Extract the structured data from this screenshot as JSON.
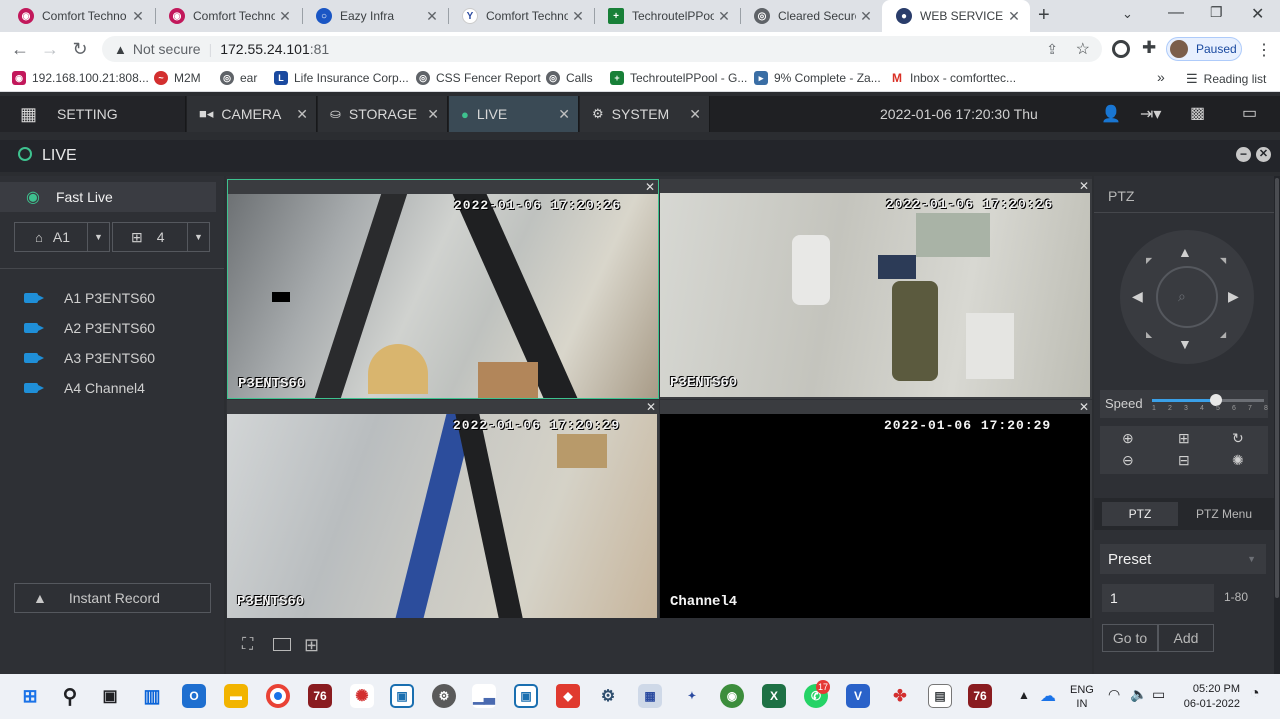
{
  "browser": {
    "tabs": [
      {
        "title": "Comfort Techno",
        "color": "#c2185b"
      },
      {
        "title": "Comfort Techno",
        "color": "#c2185b"
      },
      {
        "title": "Eazy Infra",
        "color": "#1a56c4"
      },
      {
        "title": "Comfort Techno",
        "color": "#2a4aa0"
      },
      {
        "title": "TechroutelPPool",
        "color": "#188038"
      },
      {
        "title": "Cleared Secured",
        "color": "#5f6368"
      },
      {
        "title": "WEB SERVICE",
        "color": "#2a3d6b"
      }
    ],
    "new_tab": "+",
    "security_label": "Not secure",
    "url_host": "172.55.24.101",
    "url_port": ":81",
    "profile_label": "Paused",
    "bookmarks": [
      {
        "label": "192.168.100.21:808...",
        "color": "#c2185b"
      },
      {
        "label": "M2M",
        "color": "#d32f2f"
      },
      {
        "label": "ear",
        "color": "#5f6368"
      },
      {
        "label": "Life Insurance Corp...",
        "color": "#1a4aa0"
      },
      {
        "label": "CSS Fencer Report",
        "color": "#5f6368"
      },
      {
        "label": "Calls",
        "color": "#5f6368"
      },
      {
        "label": "TechroutelPPool - G...",
        "color": "#188038"
      },
      {
        "label": "9% Complete - Za...",
        "color": "#3a6ea5"
      },
      {
        "label": "Inbox - comforttec...",
        "color": "#d93025"
      }
    ],
    "bookmarks_more": "»",
    "reading_list": "Reading list"
  },
  "app": {
    "nav_tabs": [
      {
        "label": "SETTING"
      },
      {
        "label": "CAMERA"
      },
      {
        "label": "STORAGE"
      },
      {
        "label": "LIVE"
      },
      {
        "label": "SYSTEM"
      }
    ],
    "datetime": "2022-01-06 17:20:30 Thu",
    "live_title": "LIVE",
    "fast_live": "Fast Live",
    "channel_select": "A1",
    "split_select": "4",
    "cameras": [
      {
        "label": "A1 P3ENTS60"
      },
      {
        "label": "A2 P3ENTS60"
      },
      {
        "label": "A3 P3ENTS60"
      },
      {
        "label": "A4 Channel4"
      }
    ],
    "instant_record": "Instant Record",
    "video_cells": [
      {
        "timestamp": "2022-01-06 17:20:26",
        "label": "P3ENTS60"
      },
      {
        "timestamp": "2022-01-06 17:20:26",
        "label": "P3ENTS60"
      },
      {
        "timestamp": "2022-01-06 17:20:29",
        "label": "P3ENTS60"
      },
      {
        "timestamp": "2022-01-06 17:20:29",
        "label": "Channel4"
      }
    ],
    "ptz": {
      "title": "PTZ",
      "speed_label": "Speed",
      "speed_ticks": [
        "1",
        "2",
        "3",
        "4",
        "5",
        "6",
        "7",
        "8"
      ],
      "speed_value": 5,
      "tab_ptz": "PTZ",
      "tab_menu": "PTZ Menu",
      "preset_select": "Preset",
      "preset_input": "1",
      "preset_range": "1-80",
      "goto_label": "Go to",
      "add_label": "Add"
    }
  },
  "taskbar": {
    "lang_top": "ENG",
    "lang_bottom": "IN",
    "time": "05:20 PM",
    "date": "06-01-2022",
    "whatsapp_badge": "17"
  }
}
